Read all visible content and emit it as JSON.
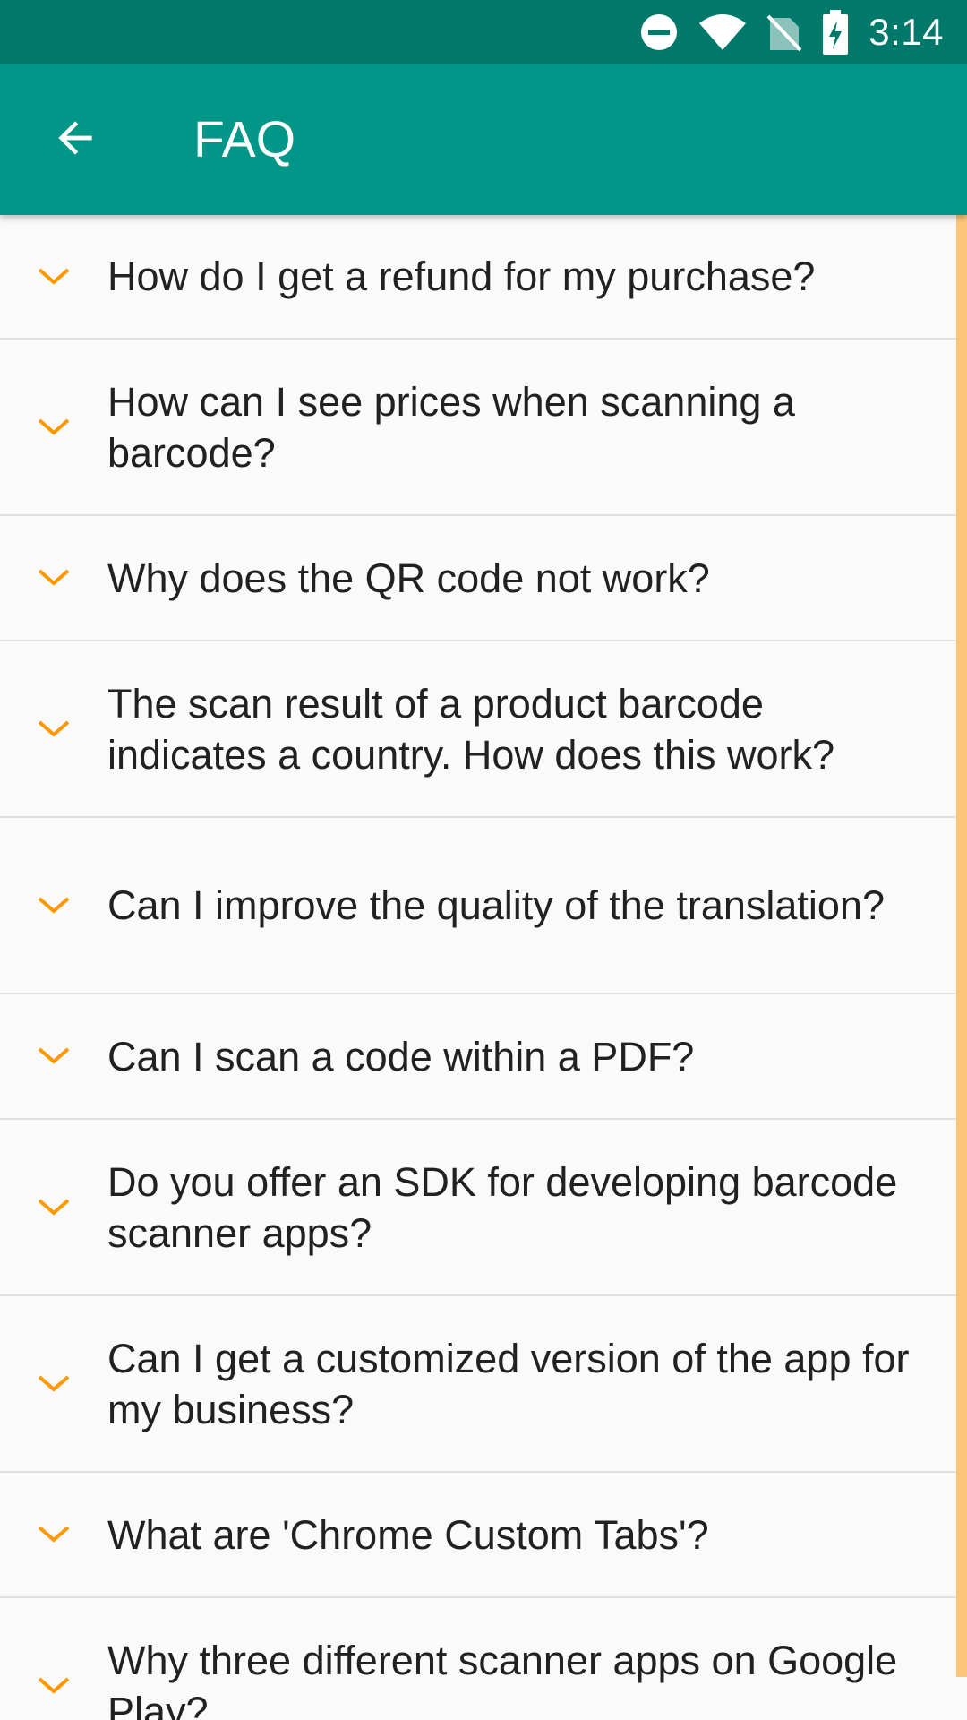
{
  "status_bar": {
    "time": "3:14",
    "icons": [
      "do-not-disturb-icon",
      "wifi-icon",
      "no-sim-icon",
      "battery-charging-icon"
    ]
  },
  "app_bar": {
    "title": "FAQ",
    "back_icon": "arrow-back-icon"
  },
  "colors": {
    "status_bar": "#00796b",
    "app_bar": "#009688",
    "chevron": "#ff9800",
    "scrollbar": "#fcc67a",
    "divider": "#e0e0e0"
  },
  "faq": [
    "How do I get a refund for my purchase?",
    "How can I see prices when scanning a barcode?",
    "Why does the QR code not work?",
    "The scan result of a product barcode indicates a country. How does this work?",
    "Can I improve the quality of the translation?",
    "Can I scan a code within a PDF?",
    "Do you offer an SDK for developing barcode scanner apps?",
    "Can I get a customized version of the app for my business?",
    "What are 'Chrome Custom Tabs'?",
    "Why three different scanner apps on Google Play?"
  ]
}
